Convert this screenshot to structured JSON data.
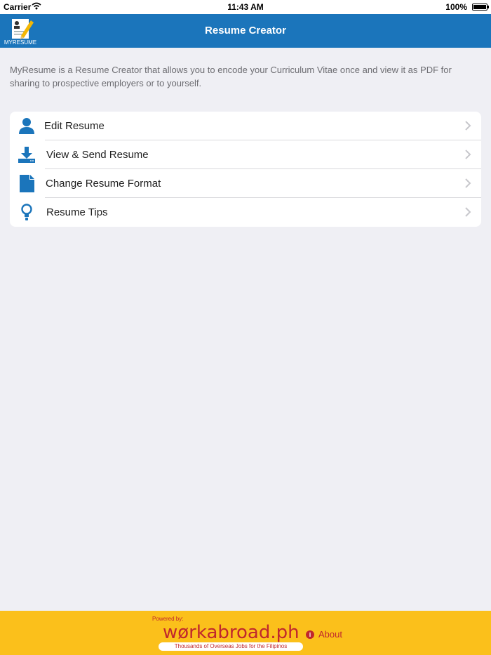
{
  "status_bar": {
    "carrier": "Carrier",
    "time": "11:43 AM",
    "battery": "100%"
  },
  "nav": {
    "logo_text": "MYRESUME",
    "title": "Resume Creator"
  },
  "intro": "MyResume is a Resume Creator that allows you to encode your Curriculum Vitae once and view it as PDF for sharing to prospective employers or to yourself.",
  "menu": {
    "items": [
      {
        "label": "Edit Resume",
        "icon": "user-icon"
      },
      {
        "label": "View & Send Resume",
        "icon": "download-icon"
      },
      {
        "label": "Change Resume Format",
        "icon": "document-icon"
      },
      {
        "label": "Resume Tips",
        "icon": "lightbulb-icon"
      }
    ]
  },
  "footer": {
    "powered_by": "Powered by:",
    "brand": "wørkabroad.ph",
    "tagline": "Thousands of Overseas Jobs for the Filipinos",
    "about": "About"
  },
  "colors": {
    "nav": "#1b75bb",
    "accent": "#1b75bb",
    "footer": "#fbc01b",
    "brand_red": "#c0272d",
    "background": "#efeff4"
  }
}
